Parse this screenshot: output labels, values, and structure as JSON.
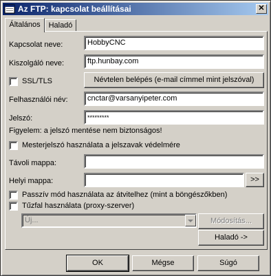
{
  "window": {
    "title": "Az FTP: kapcsolat beállításai"
  },
  "tabs": [
    {
      "label": "Általános"
    },
    {
      "label": "Haladó"
    }
  ],
  "form": {
    "connection_name_label": "Kapcsolat neve:",
    "connection_name_value": "HobbyCNC",
    "server_label": "Kiszolgáló neve:",
    "server_value": "ftp.hunbay.com",
    "ssl_label": "SSL/TLS",
    "anonymous_button": "Névtelen belépés (e-mail címmel mint jelszóval)",
    "username_label": "Felhasználói név:",
    "username_value": "cnctar@varsanyipeter.com",
    "password_label": "Jelszó:",
    "password_value": "*********",
    "warning": "Figyelem: a jelszó mentése nem biztonságos!",
    "master_password_label": "Mesterjelszó használata a jelszavak védelmére",
    "remote_folder_label": "Távoli mappa:",
    "remote_folder_value": "",
    "local_folder_label": "Helyi mappa:",
    "local_folder_value": "",
    "browse_button": ">>",
    "passive_label": "Passzív mód használata az átvitelhez (mint a böngészőkben)",
    "firewall_label": "Tűzfal használata (proxy-szerver)",
    "proxy_select_value": "Új...",
    "modify_button": "Módosítás...",
    "advanced_button": "Haladó ->"
  },
  "footer": {
    "ok": "OK",
    "cancel": "Mégse",
    "help": "Súgó"
  }
}
